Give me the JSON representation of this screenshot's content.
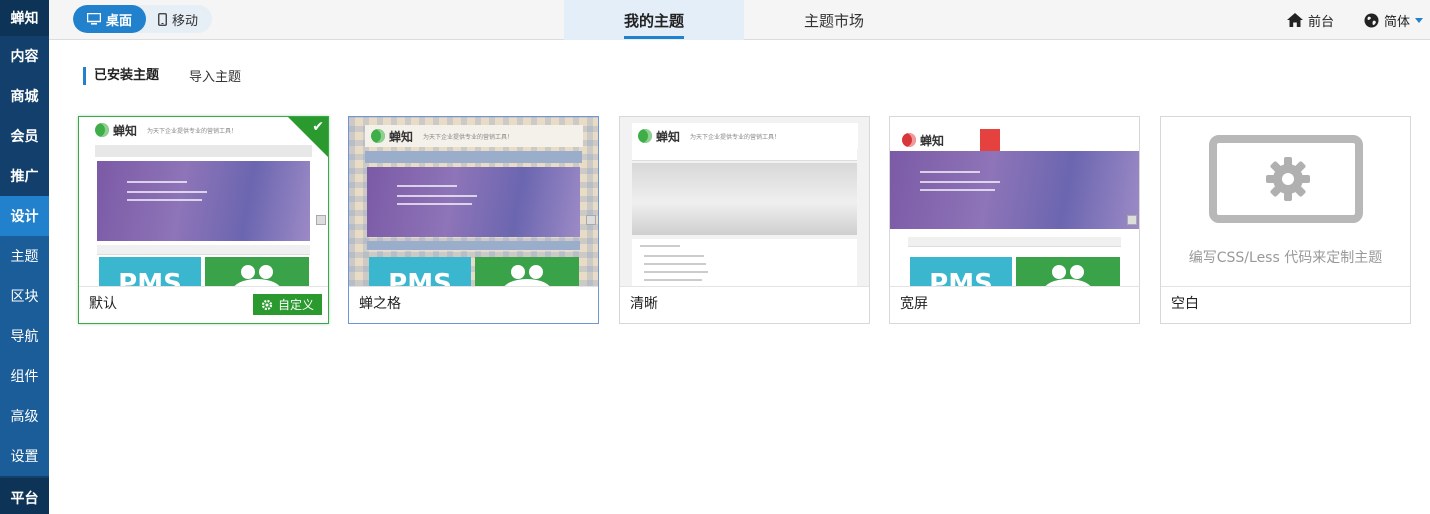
{
  "sidebar": {
    "brand": "蝉知",
    "items": [
      {
        "label": "内容"
      },
      {
        "label": "商城"
      },
      {
        "label": "会员"
      },
      {
        "label": "推广"
      },
      {
        "label": "设计"
      },
      {
        "label": "主题"
      },
      {
        "label": "区块"
      },
      {
        "label": "导航"
      },
      {
        "label": "组件"
      },
      {
        "label": "高级"
      },
      {
        "label": "设置"
      },
      {
        "label": "平台"
      }
    ]
  },
  "topbar": {
    "device_toggle": {
      "desktop_label": "桌面",
      "mobile_label": "移动",
      "selected": "桌面"
    },
    "tabs": [
      {
        "label": "我的主题",
        "active": true
      },
      {
        "label": "主题市场",
        "active": false
      }
    ],
    "frontend_label": "前台",
    "language_label": "简体"
  },
  "subnav": {
    "installed_label": "已安装主题",
    "import_label": "导入主题"
  },
  "themes": [
    {
      "name": "默认",
      "current": true,
      "action_label": "自定义",
      "preview_logo": "蝉知",
      "preview_tagline": "为天下企业提供专业的营销工具！",
      "preview_pms": "PMS"
    },
    {
      "name": "蝉之格",
      "current": false,
      "preview_logo": "蝉知",
      "preview_tagline": "为天下企业提供专业的营销工具！",
      "preview_pms": "PMS"
    },
    {
      "name": "清晰",
      "current": false,
      "preview_logo": "蝉知",
      "preview_tagline": "为天下企业提供专业的营销工具！"
    },
    {
      "name": "宽屏",
      "current": false,
      "preview_logo": "蝉知",
      "preview_pms": "PMS"
    },
    {
      "name": "空白",
      "current": false,
      "blank_caption": "编写CSS/Less 代码来定制主题"
    }
  ],
  "colors": {
    "sidebar_bg": "#123f6b",
    "accent_blue": "#2181cd",
    "success_green": "#2a9a2f"
  },
  "icons": {
    "desktop": "monitor-icon",
    "mobile": "tablet-icon",
    "home": "home-icon",
    "globe": "globe-icon",
    "check": "check-icon",
    "gear": "gear-icon"
  }
}
